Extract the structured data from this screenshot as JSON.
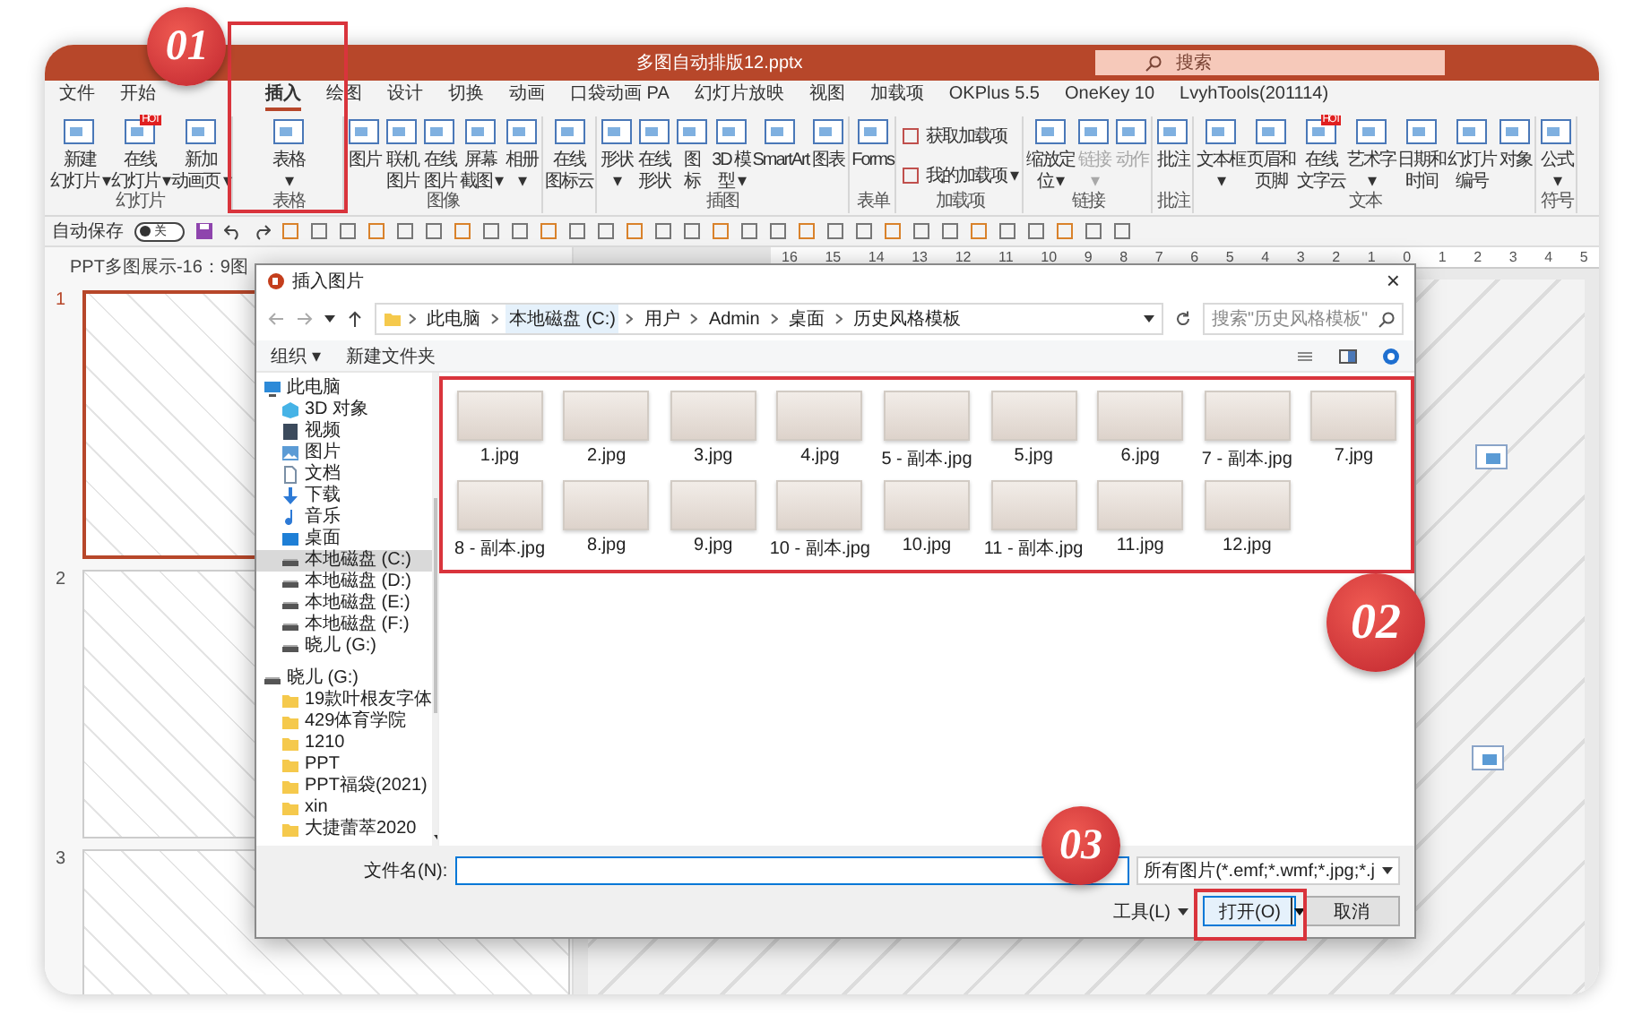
{
  "window": {
    "title": "多图自动排版12.pptx",
    "search_placeholder": "搜索"
  },
  "tabs": [
    {
      "label": "文件",
      "selected": false
    },
    {
      "label": "开始",
      "selected": false
    },
    {
      "label": "插入",
      "selected": true
    },
    {
      "label": "绘图",
      "selected": false
    },
    {
      "label": "设计",
      "selected": false
    },
    {
      "label": "切换",
      "selected": false
    },
    {
      "label": "动画",
      "selected": false
    },
    {
      "label": "口袋动画 PA",
      "selected": false
    },
    {
      "label": "幻灯片放映",
      "selected": false
    },
    {
      "label": "视图",
      "selected": false
    },
    {
      "label": "加载项",
      "selected": false
    },
    {
      "label": "OKPlus 5.5",
      "selected": false
    },
    {
      "label": "OneKey 10",
      "selected": false
    },
    {
      "label": "LvyhTools(201114)",
      "selected": false
    }
  ],
  "ribbon": [
    {
      "label": "幻灯片",
      "items": [
        {
          "kind": "large",
          "lines": [
            "新建",
            "幻灯片 ▾"
          ],
          "disabled": false
        },
        {
          "kind": "large",
          "lines": [
            "在线",
            "幻灯片 ▾"
          ],
          "badge": "HOT",
          "disabled": false
        },
        {
          "kind": "large",
          "lines": [
            "新加",
            "动画页 ▾"
          ],
          "disabled": false
        }
      ]
    },
    {
      "label": "表格",
      "callout": "01",
      "items": [
        {
          "kind": "large",
          "lines": [
            "表格",
            "▾"
          ],
          "disabled": false
        }
      ]
    },
    {
      "label": "图像",
      "items": [
        {
          "kind": "large",
          "lines": [
            "图片"
          ],
          "disabled": false
        },
        {
          "kind": "large",
          "lines": [
            "联机",
            "图片"
          ],
          "disabled": false
        },
        {
          "kind": "large",
          "lines": [
            "在线",
            "图片"
          ],
          "disabled": false
        },
        {
          "kind": "large",
          "lines": [
            "屏幕",
            "截图 ▾"
          ],
          "disabled": false
        },
        {
          "kind": "large",
          "lines": [
            "相册",
            "▾"
          ],
          "disabled": false
        }
      ]
    },
    {
      "items": [
        {
          "kind": "large",
          "lines": [
            "在线",
            "图标云"
          ],
          "disabled": false
        }
      ]
    },
    {
      "label": "插图",
      "items": [
        {
          "kind": "large",
          "lines": [
            "形状",
            "▾"
          ],
          "disabled": false
        },
        {
          "kind": "large",
          "lines": [
            "在线",
            "形状"
          ],
          "disabled": false
        },
        {
          "kind": "large",
          "lines": [
            "图",
            "标"
          ],
          "disabled": false
        },
        {
          "kind": "large",
          "lines": [
            "3D 模",
            "型 ▾"
          ],
          "disabled": false
        },
        {
          "kind": "large",
          "lines": [
            "SmartArt"
          ],
          "disabled": false
        },
        {
          "kind": "large",
          "lines": [
            "图表"
          ],
          "disabled": false
        }
      ]
    },
    {
      "label": "表单",
      "items": [
        {
          "kind": "large",
          "lines": [
            "Forms"
          ],
          "disabled": false
        }
      ]
    },
    {
      "label": "加载项",
      "items": [
        {
          "kind": "small",
          "lines": [
            "获取加载项"
          ],
          "disabled": false
        },
        {
          "kind": "small",
          "lines": [
            "我的加载项 ▾"
          ],
          "disabled": false
        }
      ]
    },
    {
      "label": "链接",
      "items": [
        {
          "kind": "large",
          "lines": [
            "缩放定",
            "位 ▾"
          ],
          "disabled": false
        },
        {
          "kind": "large",
          "lines": [
            "链接",
            "▾"
          ],
          "disabled": true
        },
        {
          "kind": "large",
          "lines": [
            "动作"
          ],
          "disabled": true
        }
      ]
    },
    {
      "label": "批注",
      "items": [
        {
          "kind": "large",
          "lines": [
            "批注"
          ],
          "disabled": false
        }
      ]
    },
    {
      "label": "文本",
      "items": [
        {
          "kind": "large",
          "lines": [
            "文本框",
            "▾"
          ],
          "disabled": false
        },
        {
          "kind": "large",
          "lines": [
            "页眉和",
            "页脚"
          ],
          "disabled": false
        },
        {
          "kind": "large",
          "lines": [
            "在线",
            "文字云"
          ],
          "badge": "HOT",
          "disabled": false
        },
        {
          "kind": "large",
          "lines": [
            "艺术字",
            "▾"
          ],
          "disabled": false
        },
        {
          "kind": "large",
          "lines": [
            "日期和",
            "时间"
          ],
          "disabled": false
        },
        {
          "kind": "large",
          "lines": [
            "幻灯片",
            "编号"
          ],
          "disabled": false
        },
        {
          "kind": "large",
          "lines": [
            "对象"
          ],
          "disabled": false
        }
      ]
    },
    {
      "label": "符号",
      "items": [
        {
          "kind": "large",
          "lines": [
            "公式",
            "▾"
          ],
          "disabled": false
        }
      ]
    }
  ],
  "quick_access": {
    "label": "自动保存",
    "toggle_text": "关",
    "on": false
  },
  "slide_panel": {
    "title": "PPT多图展示-16：9图",
    "slides": [
      {
        "number": "1",
        "selected": true
      },
      {
        "number": "2",
        "selected": false
      },
      {
        "number": "3",
        "selected": false
      }
    ]
  },
  "ruler": [
    "16",
    "15",
    "14",
    "13",
    "12",
    "11",
    "10",
    "9",
    "8",
    "7",
    "6",
    "5",
    "4",
    "3",
    "2",
    "1",
    "0",
    "1",
    "2",
    "3",
    "4",
    "5"
  ],
  "dialog": {
    "title": "插入图片",
    "close": "×",
    "path": [
      "此电脑",
      "本地磁盘 (C:)",
      "用户",
      "Admin",
      "桌面",
      "历史风格模板"
    ],
    "search_placeholder": "搜索\"历史风格模板\"",
    "toolbar": [
      "组织 ▾",
      "新建文件夹"
    ],
    "tree": [
      {
        "label": "此电脑",
        "kind": "pc",
        "selected": false,
        "children": [
          {
            "label": "3D 对象",
            "kind": "object",
            "selected": false
          },
          {
            "label": "视频",
            "kind": "video",
            "selected": false
          },
          {
            "label": "图片",
            "kind": "pictures",
            "selected": false
          },
          {
            "label": "文档",
            "kind": "docs",
            "selected": false
          },
          {
            "label": "下载",
            "kind": "download",
            "selected": false
          },
          {
            "label": "音乐",
            "kind": "music",
            "selected": false
          },
          {
            "label": "桌面",
            "kind": "desktop",
            "selected": false
          },
          {
            "label": "本地磁盘 (C:)",
            "kind": "drive",
            "selected": true
          },
          {
            "label": "本地磁盘 (D:)",
            "kind": "drive",
            "selected": false
          },
          {
            "label": "本地磁盘 (E:)",
            "kind": "drive",
            "selected": false
          },
          {
            "label": "本地磁盘 (F:)",
            "kind": "drive",
            "selected": false
          },
          {
            "label": "晓儿 (G:)",
            "kind": "drive",
            "selected": false
          }
        ]
      },
      {
        "label": "晓儿 (G:)",
        "kind": "drive",
        "selected": false,
        "children": [
          {
            "label": "19款叶根友字体",
            "kind": "folder",
            "selected": false
          },
          {
            "label": "429体育学院",
            "kind": "folder",
            "selected": false
          },
          {
            "label": "1210",
            "kind": "folder",
            "selected": false
          },
          {
            "label": "PPT",
            "kind": "folder",
            "selected": false
          },
          {
            "label": "PPT福袋(2021)",
            "kind": "folder",
            "selected": false
          },
          {
            "label": "xin",
            "kind": "folder",
            "selected": false
          },
          {
            "label": "大捷蕾萃2020",
            "kind": "folder",
            "selected": false
          }
        ]
      }
    ],
    "callout": "02",
    "files": [
      "1.jpg",
      "2.jpg",
      "3.jpg",
      "4.jpg",
      "5 - 副本.jpg",
      "5.jpg",
      "6.jpg",
      "7 - 副本.jpg",
      "7.jpg",
      "8 - 副本.jpg",
      "8.jpg",
      "9.jpg",
      "10 - 副本.jpg",
      "10.jpg",
      "11 - 副本.jpg",
      "11.jpg",
      "12.jpg"
    ],
    "filename_label": "文件名(N):",
    "filter": "所有图片(*.emf;*.wmf;*.jpg;*.j",
    "tools": "工具(L)",
    "open": "打开(O)",
    "open_callout": "03",
    "cancel": "取消"
  }
}
